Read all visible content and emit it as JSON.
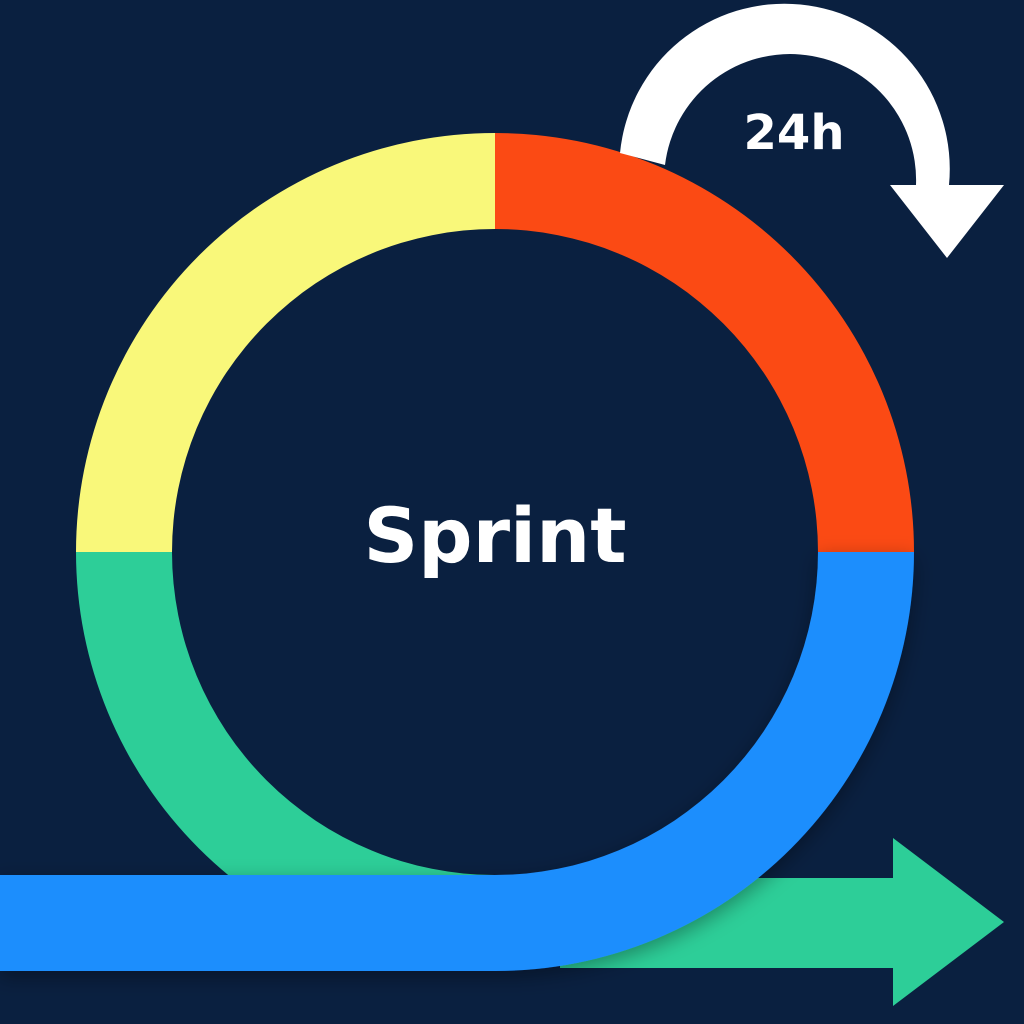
{
  "diagram": {
    "center_label": "Sprint",
    "cycle_label": "24h",
    "colors": {
      "background": "#0a2040",
      "ring_top_left": "#f9f87a",
      "ring_top_right": "#fb4a14",
      "ring_bottom_right": "#1e8efd",
      "ring_bottom_left": "#2dce98",
      "output_arrow": "#2dce98",
      "input_arrow": "#1e8efd",
      "cycle_arrow": "#ffffff"
    },
    "icons": {
      "cycle_arrow": "curved-clockwise-arrow",
      "output_arrow": "right-arrow"
    }
  }
}
